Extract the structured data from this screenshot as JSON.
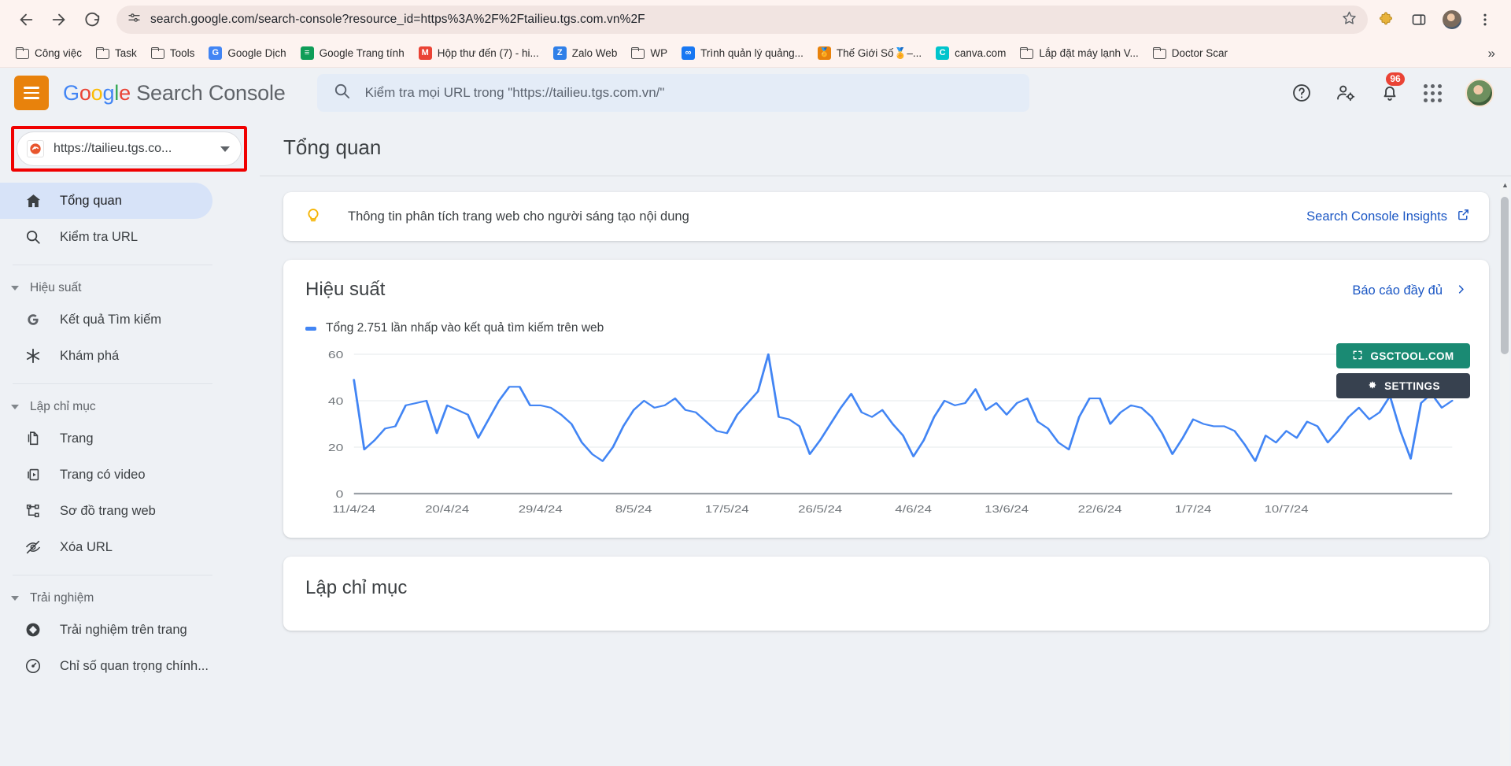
{
  "browser": {
    "back_icon": "back-arrow-icon",
    "forward_icon": "forward-arrow-icon",
    "reload_icon": "reload-icon",
    "site_info_icon": "site-settings-icon",
    "url": "search.google.com/search-console?resource_id=https%3A%2F%2Ftailieu.tgs.com.vn%2F",
    "bookmark_star_icon": "star-icon",
    "extensions_icon": "extensions-icon",
    "profile_icon": "profile-avatar-icon",
    "menu_icon": "kebab-menu-icon",
    "bookmarks": [
      {
        "label": "Công việc",
        "icon": "folder-icon",
        "type": "folder"
      },
      {
        "label": "Task",
        "icon": "folder-icon",
        "type": "folder"
      },
      {
        "label": "Tools",
        "icon": "folder-icon",
        "type": "folder"
      },
      {
        "label": "Google Dịch",
        "icon": "google-translate-icon",
        "type": "site",
        "color": "#4285f4",
        "glyph": "G"
      },
      {
        "label": "Google Trang tính",
        "icon": "google-sheets-icon",
        "type": "site",
        "color": "#0f9d58",
        "glyph": "≡"
      },
      {
        "label": "Hộp thư đến (7) - hi...",
        "icon": "gmail-icon",
        "type": "site",
        "color": "#ea4335",
        "glyph": "M"
      },
      {
        "label": "Zalo Web",
        "icon": "zalo-icon",
        "type": "site",
        "color": "#2f7fe8",
        "glyph": "Z"
      },
      {
        "label": "WP",
        "icon": "folder-icon",
        "type": "folder"
      },
      {
        "label": "Trình quản lý quảng...",
        "icon": "meta-icon",
        "type": "site",
        "color": "#1877f2",
        "glyph": "∞"
      },
      {
        "label": "Thế Giới Số🏅–...",
        "icon": "medal-icon",
        "type": "site",
        "color": "#e8820c",
        "glyph": "🏅"
      },
      {
        "label": "canva.com",
        "icon": "canva-icon",
        "type": "site",
        "color": "#00c4cc",
        "glyph": "C"
      },
      {
        "label": "Lắp đặt máy lạnh V...",
        "icon": "folder-icon",
        "type": "folder"
      },
      {
        "label": "Doctor Scar",
        "icon": "folder-icon",
        "type": "folder"
      }
    ],
    "overflow_label": "»"
  },
  "header": {
    "menu_icon": "hamburger-menu-icon",
    "brand_google": "Google",
    "brand_product": "Search Console",
    "search_icon": "search-icon",
    "search_placeholder": "Kiểm tra mọi URL trong \"https://tailieu.tgs.com.vn/\"",
    "help_icon": "help-circle-icon",
    "accounts_icon": "user-settings-icon",
    "notifications_icon": "bell-icon",
    "notifications_count": "96",
    "apps_icon": "apps-grid-icon",
    "avatar_icon": "user-avatar-icon"
  },
  "sidebar": {
    "property": {
      "favicon": "site-favicon",
      "label": "https://tailieu.tgs.co...",
      "dropdown_icon": "chevron-down-icon"
    },
    "items": [
      {
        "label": "Tổng quan",
        "icon": "home-icon",
        "active": true
      },
      {
        "label": "Kiểm tra URL",
        "icon": "search-icon",
        "active": false
      }
    ],
    "groups": [
      {
        "label": "Hiệu suất",
        "toggle_icon": "triangle-down-icon",
        "items": [
          {
            "label": "Kết quả Tìm kiếm",
            "icon": "google-g-icon"
          },
          {
            "label": "Khám phá",
            "icon": "discover-asterisk-icon"
          }
        ]
      },
      {
        "label": "Lập chỉ mục",
        "toggle_icon": "triangle-down-icon",
        "items": [
          {
            "label": "Trang",
            "icon": "pages-icon"
          },
          {
            "label": "Trang có video",
            "icon": "video-page-icon"
          },
          {
            "label": "Sơ đồ trang web",
            "icon": "sitemap-icon"
          },
          {
            "label": "Xóa URL",
            "icon": "eye-off-icon"
          }
        ]
      },
      {
        "label": "Trải nghiệm",
        "toggle_icon": "triangle-down-icon",
        "items": [
          {
            "label": "Trải nghiệm trên trang",
            "icon": "page-experience-icon"
          },
          {
            "label": "Chỉ số quan trọng chính...",
            "icon": "core-web-vitals-icon"
          }
        ]
      }
    ]
  },
  "main": {
    "page_title": "Tổng quan",
    "insights": {
      "bulb_icon": "lightbulb-icon",
      "text": "Thông tin phân tích trang web cho người sáng tạo nội dung",
      "link_label": "Search Console Insights",
      "link_icon": "external-link-icon"
    },
    "performance": {
      "title": "Hiệu suất",
      "full_report_label": "Báo cáo đầy đủ",
      "full_report_icon": "chevron-right-icon",
      "legend_label": "Tổng 2.751 lần nhấp vào kết quả tìm kiếm trên web",
      "legend_color": "#4285f4"
    },
    "overlay_buttons": [
      {
        "label": "GSCTOOL.COM",
        "icon": "expand-icon",
        "color": "#1a8a73"
      },
      {
        "label": "SETTINGS",
        "icon": "gear-icon",
        "color": "#37414f"
      }
    ],
    "indexing": {
      "title": "Lập chỉ mục"
    },
    "scrollbar": {
      "up_arrow_icon": "scroll-up-arrow-icon",
      "down_arrow_icon": "scroll-down-arrow-icon"
    }
  },
  "chart_data": {
    "type": "line",
    "title": "Hiệu suất",
    "series_name": "Tổng 2.751 lần nhấp vào kết quả tìm kiếm trên web",
    "color": "#4285f4",
    "ylabel": "",
    "xlabel": "",
    "ylim": [
      0,
      60
    ],
    "yticks": [
      0,
      20,
      40,
      60
    ],
    "grid": true,
    "legend_position": "top-left",
    "tick_labels": [
      "11/4/24",
      "20/4/24",
      "29/4/24",
      "8/5/24",
      "17/5/24",
      "26/5/24",
      "4/6/24",
      "13/6/24",
      "22/6/24",
      "1/7/24",
      "10/7/24"
    ],
    "tick_indices": [
      0,
      9,
      18,
      27,
      36,
      45,
      54,
      63,
      72,
      81,
      90
    ],
    "x_start": "11/4/24",
    "x_end": "10/7/24",
    "values": [
      49,
      19,
      23,
      28,
      29,
      38,
      39,
      40,
      26,
      38,
      36,
      34,
      24,
      32,
      40,
      46,
      46,
      38,
      38,
      37,
      34,
      30,
      22,
      17,
      14,
      20,
      29,
      36,
      40,
      37,
      38,
      41,
      36,
      35,
      31,
      27,
      26,
      34,
      39,
      44,
      60,
      33,
      32,
      29,
      17,
      23,
      30,
      37,
      43,
      35,
      33,
      36,
      30,
      25,
      16,
      23,
      33,
      40,
      38,
      39,
      45,
      36,
      39,
      34,
      39,
      41,
      31,
      28,
      22,
      19,
      33,
      41,
      41,
      30,
      35,
      38,
      37,
      33,
      26,
      17,
      24,
      32,
      30,
      29,
      29,
      27,
      21,
      14,
      25,
      22,
      27,
      24,
      31,
      29,
      22,
      27,
      33,
      37,
      32,
      35,
      42,
      27,
      15,
      39,
      43,
      37,
      40
    ]
  }
}
